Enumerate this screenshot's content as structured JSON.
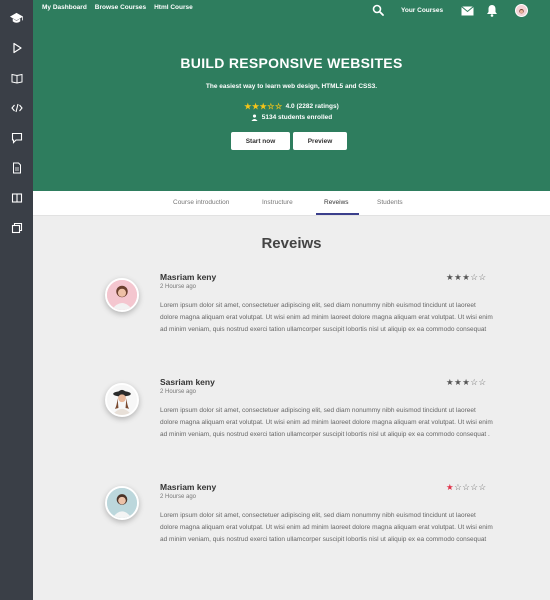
{
  "sidebar": {
    "icons": [
      "graduation-cap-icon",
      "play-icon",
      "book-open-icon",
      "code-icon",
      "chat-icon",
      "document-icon",
      "columns-icon",
      "copy-icon"
    ]
  },
  "topnav": {
    "links": [
      "My Dashboard",
      "Browse Courses",
      "Html Course"
    ],
    "your_courses": "Your Courses"
  },
  "hero": {
    "title": "BUILD RESPONSIVE WEBSITES",
    "subtitle": "The easiest way to learn web design, HTML5 and CSS3.",
    "rating_stars": "★★★☆☆",
    "rating_text": "4.0 (2282 ratings)",
    "students_text": "5134 students enrolled",
    "start_label": "Start now",
    "preview_label": "Preview"
  },
  "tabs": [
    "Course introduction",
    "Instructure",
    "Reveiws",
    "Students"
  ],
  "active_tab": "Reveiws",
  "reviews_title": "Reveiws",
  "reviews": [
    {
      "name": "Masriam keny",
      "time": "2 Hourse ago",
      "rating": 3,
      "text": "Lorem ipsum dolor sit amet, consectetuer adipiscing elit, sed diam nonummy nibh euismod tincidunt ut laoreet dolore magna aliquam erat volutpat. Ut wisi enim ad minim laoreet dolore magna aliquam erat volutpat. Ut wisi enim ad minim veniam, quis nostrud exerci tation ullamcorper suscipit lobortis nisl ut aliquip ex ea commodo consequat"
    },
    {
      "name": "Sasriam keny",
      "time": "2 Hourse ago",
      "rating": 3,
      "text": "Lorem ipsum dolor sit amet, consectetuer adipiscing elit, sed diam nonummy nibh euismod tincidunt ut laoreet dolore magna aliquam erat volutpat. Ut wisi enim ad minim laoreet dolore magna aliquam erat volutpat. Ut wisi enim ad minim veniam, quis nostrud exerci tation ullamcorper suscipit lobortis nisl ut aliquip ex ea commodo consequat ."
    },
    {
      "name": "Masriam keny",
      "time": "2 Hourse ago",
      "rating": 1,
      "text": "Lorem ipsum dolor sit amet, consectetuer adipiscing elit, sed diam nonummy nibh euismod tincidunt ut laoreet dolore magna aliquam erat volutpat. Ut wisi enim ad minim laoreet dolore magna aliquam erat volutpat. Ut wisi enim ad minim veniam, quis nostrud exerci tation ullamcorper suscipit lobortis nisl ut aliquip ex ea commodo consequat"
    }
  ],
  "colors": {
    "sidebar": "#3a3f47",
    "hero": "#2e7d5e",
    "star_gold": "#f5c518",
    "star_red": "#e0334a",
    "tab_underline": "#3b3f8c"
  }
}
